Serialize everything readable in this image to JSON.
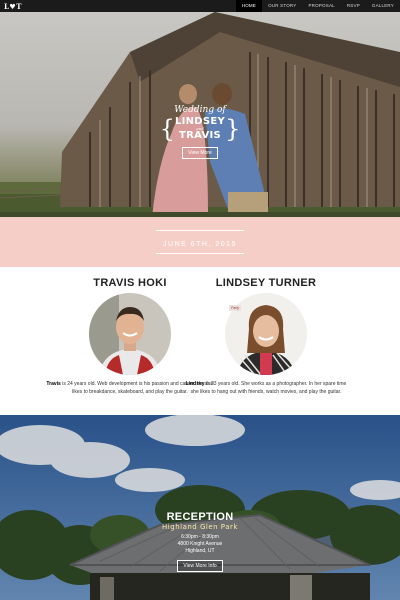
{
  "nav": {
    "logo": "L♥T",
    "items": [
      "HOME",
      "OUR STORY",
      "PROPOSAL",
      "RSVP",
      "GALLERY"
    ],
    "active": "HOME"
  },
  "hero": {
    "wedding_of": "Wedding of",
    "bride": "LINDSEY",
    "and_text": "and",
    "groom": "TRAVIS",
    "button": "View More"
  },
  "date": {
    "text": "JUNE 6TH, 2015"
  },
  "groom": {
    "name": "TRAVIS HOKI",
    "bio_name": "Travis",
    "bio_rest": " is 24 years old. Web development is his passion and career. He also likes to breakdance, skateboard, and play the guitar."
  },
  "bride": {
    "name": "LINDSEY TURNER",
    "tag": "Party",
    "bio_name": "Lindsey",
    "bio_rest": " is 23 years old. She works as a photographer. In her spare time she likes to hang out with friends, watch movies, and play the guitar."
  },
  "reception": {
    "title": "RECEPTION",
    "venue": "Highland Glen Park",
    "time": "6:30pm - 8:30pm",
    "address": "4800 Knight Avenue",
    "city": "Highland, UT",
    "button": "View More Info"
  },
  "colors": {
    "nav": "#1b1b1b",
    "date_band": "#f5cfc7",
    "accent_venue": "#ffe9a8"
  }
}
